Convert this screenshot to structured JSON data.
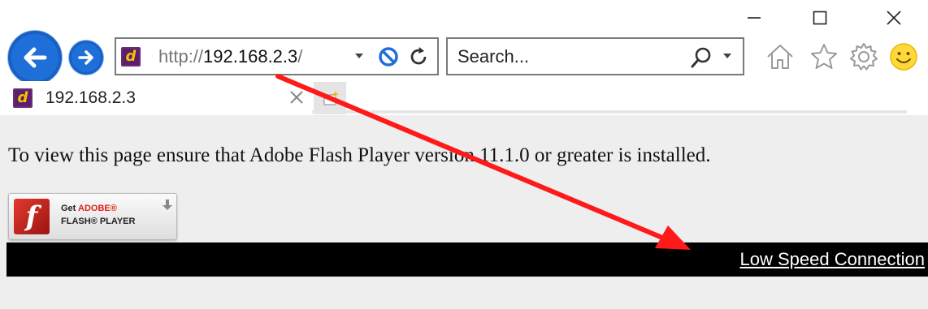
{
  "window_controls": {
    "minimize": "minimize-icon",
    "maximize": "maximize-icon",
    "close": "close-icon"
  },
  "navigation": {
    "back": "back-arrow-icon",
    "forward": "forward-arrow-icon"
  },
  "address_bar": {
    "scheme": "http://",
    "host": "192.168.2.3",
    "path": "/",
    "favicon_letter": "d"
  },
  "search_bar": {
    "placeholder": "Search..."
  },
  "toolbar_icons": [
    "home-icon",
    "star-icon",
    "gear-icon",
    "smiley-icon"
  ],
  "tab": {
    "title": "192.168.2.3",
    "favicon_letter": "d"
  },
  "content": {
    "flash_message": "To view this page ensure that Adobe Flash Player version 11.1.0 or greater is installed.",
    "flash_badge": {
      "logo_letter": "f",
      "line1_get": "Get ",
      "line1_adobe": "ADOBE®",
      "line2": "FLASH® PLAYER"
    },
    "link": "Low Speed Connection"
  },
  "colors": {
    "accent_blue": "#1f6fd8",
    "annotation_red": "#ff1a1a",
    "bar_black": "#000000",
    "content_bg": "#eeeeee",
    "favicon_purple": "#5b1f6b",
    "favicon_yellow": "#f5c400"
  }
}
